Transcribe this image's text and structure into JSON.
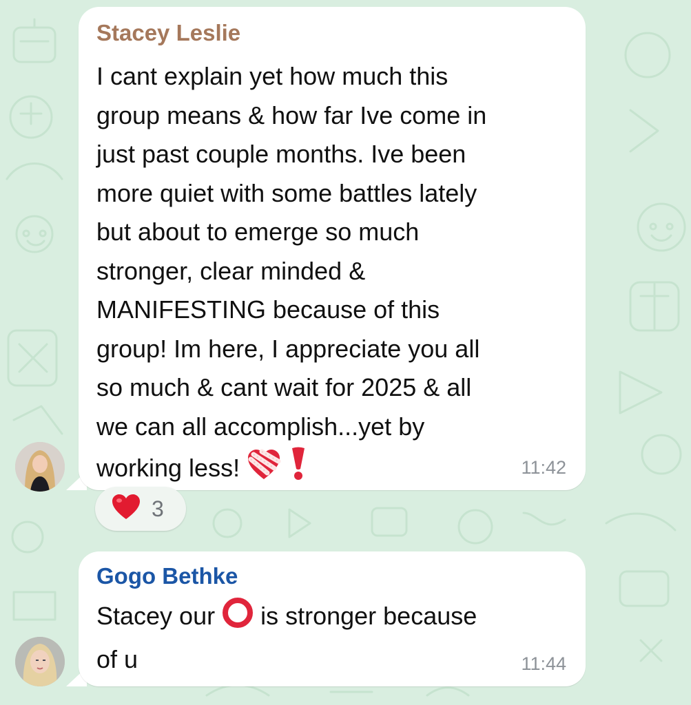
{
  "messages": [
    {
      "sender": "Stacey Leslie",
      "sender_color": "#a5785b",
      "text": "I cant explain yet how much this\ngroup means & how far Ive come in\njust past couple months. Ive been\nmore quiet with some battles lately\nbut about to emerge so much\nstronger, clear minded &\nMANIFESTING because of this\ngroup! Im here, I appreciate you all\nso much & cant wait for 2025 & all\nwe can all accomplish...yet by\nworking less!",
      "trailing_emojis": [
        "mending-heart-emoji",
        "red-exclamation-emoji"
      ],
      "time": "11:42",
      "reaction": {
        "emoji": "red-heart-emoji",
        "count": "3"
      }
    },
    {
      "sender": "Gogo Bethke",
      "sender_color": "#1b56a6",
      "text_before_emoji": "Stacey our ",
      "inline_emoji": "red-circle-emoji",
      "text_after_emoji": " is stronger because\nof u",
      "time": "11:44"
    }
  ],
  "colors": {
    "wallpaper": "#d9eee0",
    "bubble": "#ffffff",
    "timestamp": "#8d9298"
  }
}
